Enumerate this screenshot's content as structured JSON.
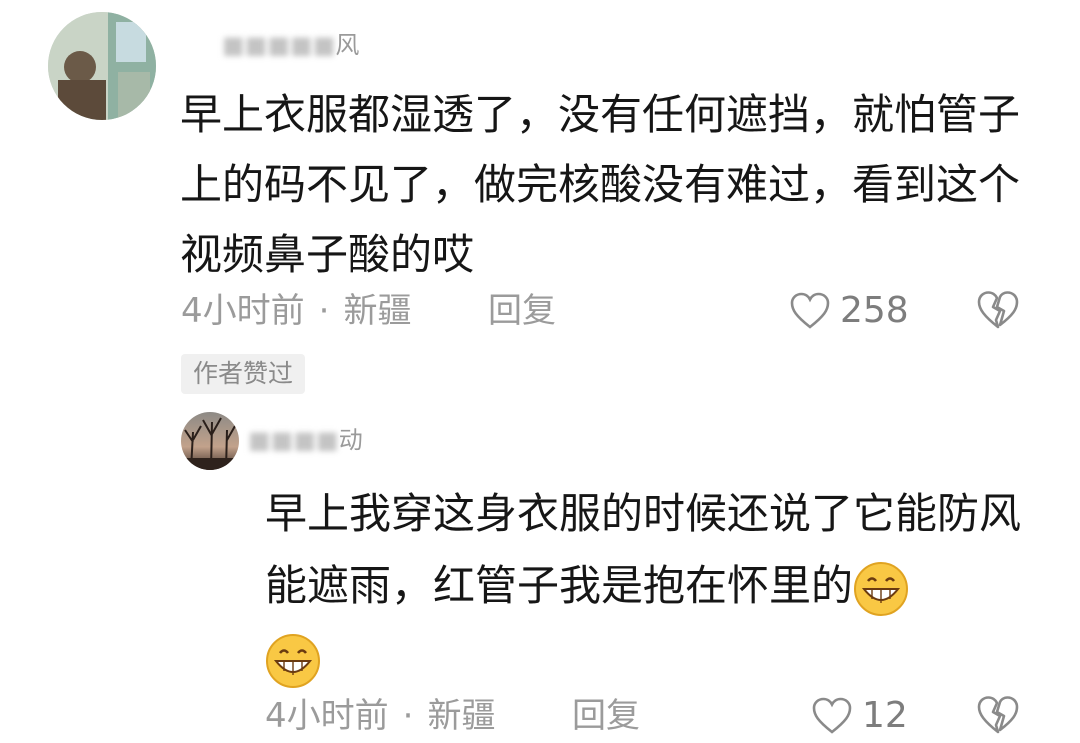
{
  "comment1": {
    "username": "风",
    "text": "早上衣服都湿透了，没有任何遮挡，就怕管子上的码不见了，做完核酸没有难过，看到这个视频鼻子酸的哎",
    "time": "4小时前",
    "separator": "·",
    "location": "新疆",
    "reply_label": "回复",
    "like_count": "258",
    "badge": "作者赞过"
  },
  "comment2": {
    "username": "动",
    "text": "早上我穿这身衣服的时候还说了它能防风能遮雨，红管子我是抱在怀里的",
    "emoji": "grinning-face",
    "time": "4小时前",
    "separator": "·",
    "location": "新疆",
    "reply_label": "回复",
    "like_count": "12"
  },
  "icons": {
    "like": "heart-outline-icon",
    "dislike": "broken-heart-icon"
  }
}
